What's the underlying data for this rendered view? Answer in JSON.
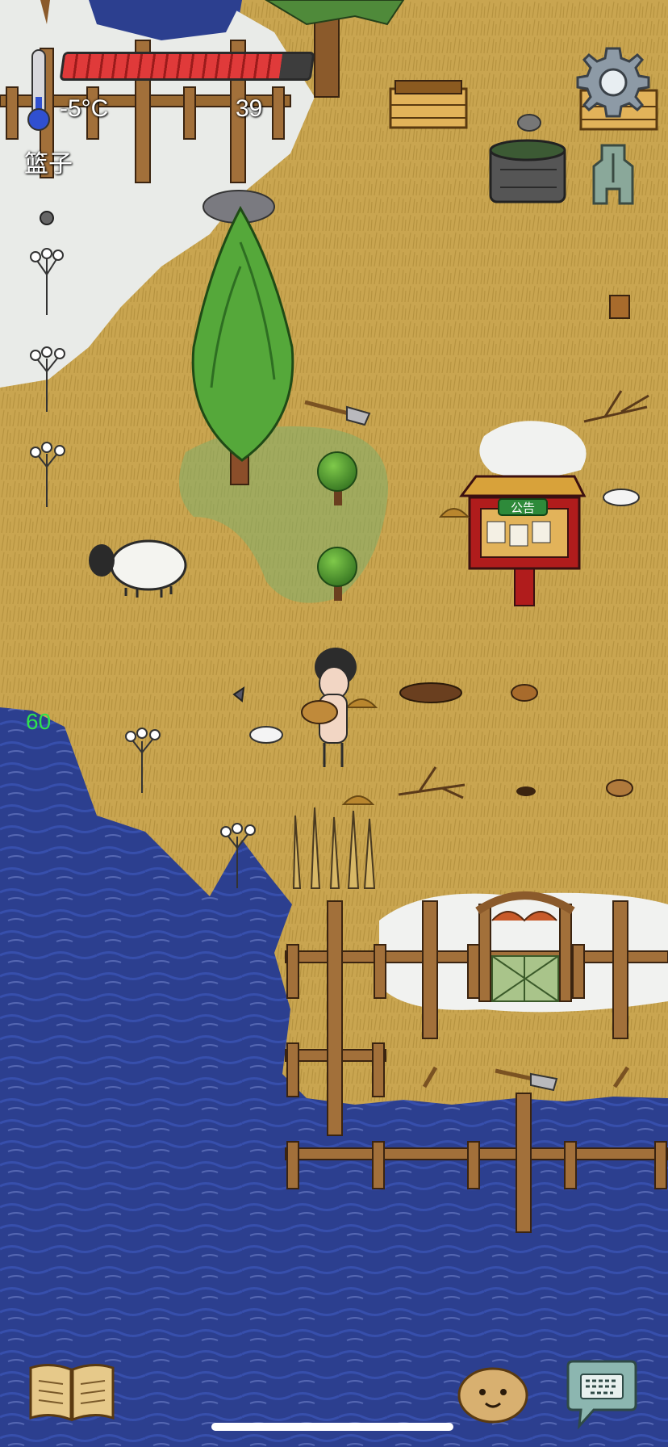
{
  "hud": {
    "temperature": "-5°C",
    "food_value": "39",
    "held_item": "篮子",
    "fps": "60",
    "health_fraction": 0.88,
    "thermometer_fraction": 0.3
  },
  "buttons": {
    "settings_icon": "gear-icon",
    "tech_icon": "ancient-coin-icon",
    "recipe_book_icon": "book-icon",
    "emote_icon": "potato-face-icon",
    "chat_icon": "keyboard-speech-icon"
  },
  "signboard": {
    "header": "公告"
  },
  "colors": {
    "water": "#2c3f8f",
    "grass": "#c9a550",
    "snow": "#e9ebe8",
    "health_red": "#e03a3a",
    "fps_green": "#2fe34d"
  }
}
